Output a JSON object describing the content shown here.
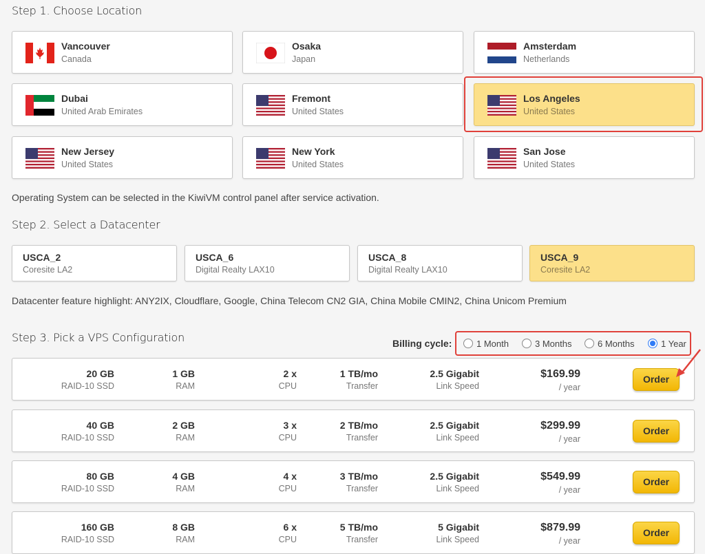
{
  "step1": {
    "title": "Step 1. Choose Location",
    "locations": [
      {
        "name": "Vancouver",
        "country": "Canada",
        "flag": "canada-flag",
        "selected": false
      },
      {
        "name": "Osaka",
        "country": "Japan",
        "flag": "japan-flag",
        "selected": false
      },
      {
        "name": "Amsterdam",
        "country": "Netherlands",
        "flag": "netherlands-flag",
        "selected": false
      },
      {
        "name": "Dubai",
        "country": "United Arab Emirates",
        "flag": "uae-flag",
        "selected": false
      },
      {
        "name": "Fremont",
        "country": "United States",
        "flag": "usa-flag",
        "selected": false
      },
      {
        "name": "Los Angeles",
        "country": "United States",
        "flag": "usa-flag",
        "selected": true
      },
      {
        "name": "New Jersey",
        "country": "United States",
        "flag": "usa-flag",
        "selected": false
      },
      {
        "name": "New York",
        "country": "United States",
        "flag": "usa-flag",
        "selected": false
      },
      {
        "name": "San Jose",
        "country": "United States",
        "flag": "usa-flag",
        "selected": false
      }
    ],
    "os_note": "Operating System can be selected in the KiwiVM control panel after service activation."
  },
  "step2": {
    "title": "Step 2. Select a Datacenter",
    "datacenters": [
      {
        "code": "USCA_2",
        "location": "Coresite LA2",
        "selected": false
      },
      {
        "code": "USCA_6",
        "location": "Digital Realty LAX10",
        "selected": false
      },
      {
        "code": "USCA_8",
        "location": "Digital Realty LAX10",
        "selected": false
      },
      {
        "code": "USCA_9",
        "location": "Coresite LA2",
        "selected": true
      }
    ],
    "feature_note": "Datacenter feature highlight: ANY2IX, Cloudflare, Google, China Telecom CN2 GIA, China Mobile CMIN2, China Unicom Premium"
  },
  "step3": {
    "title": "Step 3. Pick a VPS Configuration",
    "billing_label": "Billing cycle:",
    "billing_options": [
      {
        "label": "1 Month",
        "checked": false
      },
      {
        "label": "3 Months",
        "checked": false
      },
      {
        "label": "6 Months",
        "checked": false
      },
      {
        "label": "1 Year",
        "checked": true
      }
    ],
    "plans": [
      {
        "disk": "20 GB",
        "disk_type": "RAID-10 SSD",
        "ram": "1 GB",
        "ram_label": "RAM",
        "cpu": "2 x",
        "cpu_label": "CPU",
        "transfer": "1 TB/mo",
        "transfer_label": "Transfer",
        "link": "2.5 Gigabit",
        "link_label": "Link Speed",
        "price": "$169.99",
        "period": "/ year",
        "order_label": "Order"
      },
      {
        "disk": "40 GB",
        "disk_type": "RAID-10 SSD",
        "ram": "2 GB",
        "ram_label": "RAM",
        "cpu": "3 x",
        "cpu_label": "CPU",
        "transfer": "2 TB/mo",
        "transfer_label": "Transfer",
        "link": "2.5 Gigabit",
        "link_label": "Link Speed",
        "price": "$299.99",
        "period": "/ year",
        "order_label": "Order"
      },
      {
        "disk": "80 GB",
        "disk_type": "RAID-10 SSD",
        "ram": "4 GB",
        "ram_label": "RAM",
        "cpu": "4 x",
        "cpu_label": "CPU",
        "transfer": "3 TB/mo",
        "transfer_label": "Transfer",
        "link": "2.5 Gigabit",
        "link_label": "Link Speed",
        "price": "$549.99",
        "period": "/ year",
        "order_label": "Order"
      },
      {
        "disk": "160 GB",
        "disk_type": "RAID-10 SSD",
        "ram": "8 GB",
        "ram_label": "RAM",
        "cpu": "6 x",
        "cpu_label": "CPU",
        "transfer": "5 TB/mo",
        "transfer_label": "Transfer",
        "link": "5 Gigabit",
        "link_label": "Link Speed",
        "price": "$879.99",
        "period": "/ year",
        "order_label": "Order"
      }
    ]
  },
  "colors": {
    "selected_bg": "#fce08a",
    "highlight_red": "#e0413a",
    "order_button": "#f2b705",
    "radio_checked": "#2f7bf6"
  }
}
